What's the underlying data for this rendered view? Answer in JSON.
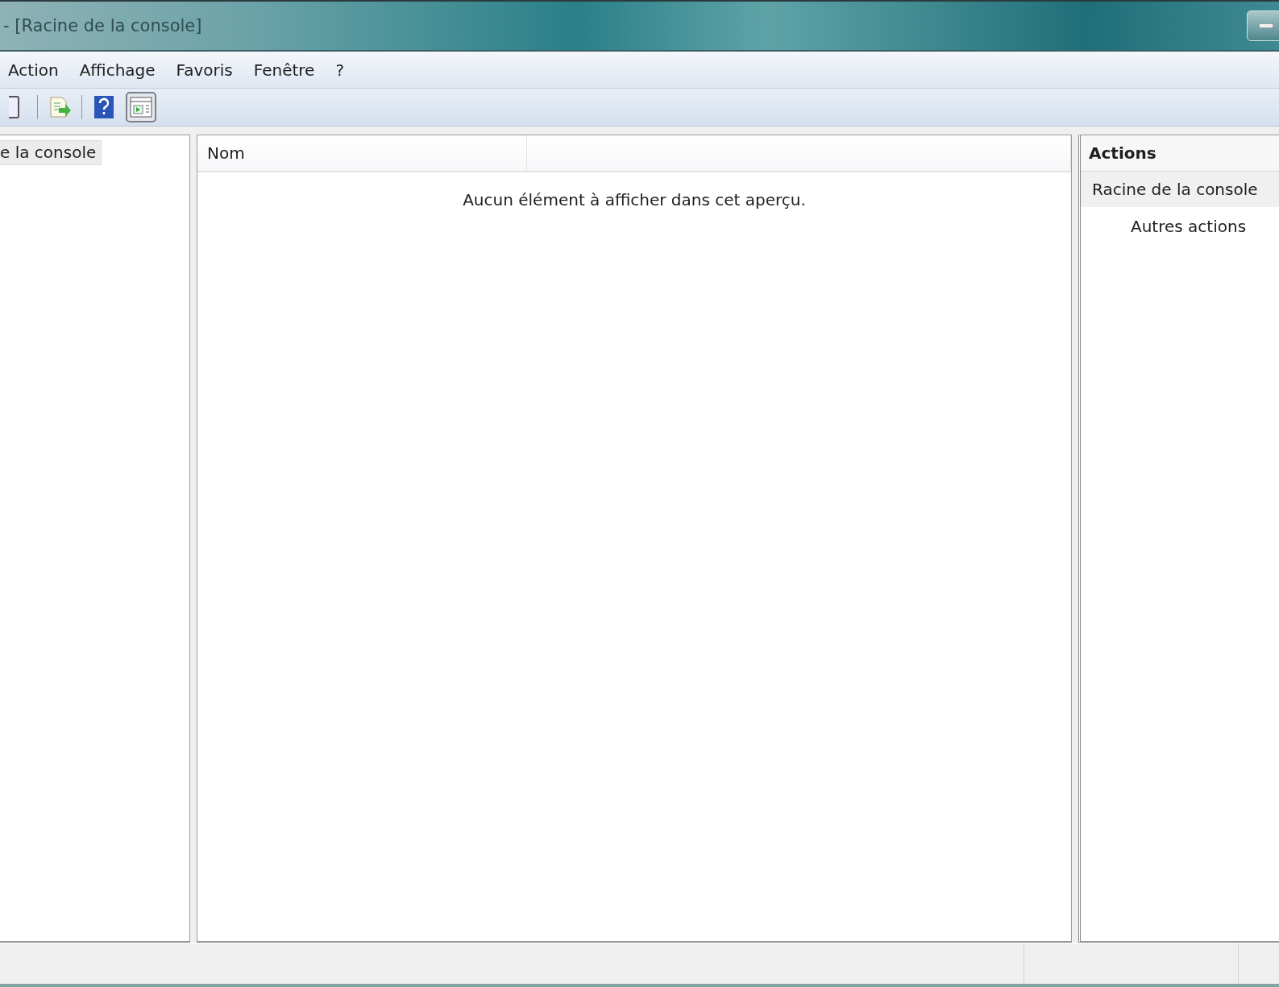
{
  "window": {
    "title": "- [Racine de la console]"
  },
  "menu": [
    "Action",
    "Affichage",
    "Favoris",
    "Fenêtre",
    "?"
  ],
  "toolbar": [
    {
      "kind": "window",
      "pressed": false
    },
    {
      "kind": "sep"
    },
    {
      "kind": "export",
      "pressed": false
    },
    {
      "kind": "sep"
    },
    {
      "kind": "help",
      "pressed": false
    },
    {
      "kind": "pane",
      "pressed": true
    }
  ],
  "tree": {
    "items": [
      {
        "label": "e la console",
        "selected": true
      }
    ]
  },
  "list": {
    "columns": [
      "Nom",
      ""
    ],
    "empty_message": "Aucun élément à afficher dans cet aperçu."
  },
  "actions": {
    "title": "Actions",
    "sections": [
      {
        "label": "Racine de la console",
        "items": [
          "Autres actions"
        ]
      }
    ]
  }
}
